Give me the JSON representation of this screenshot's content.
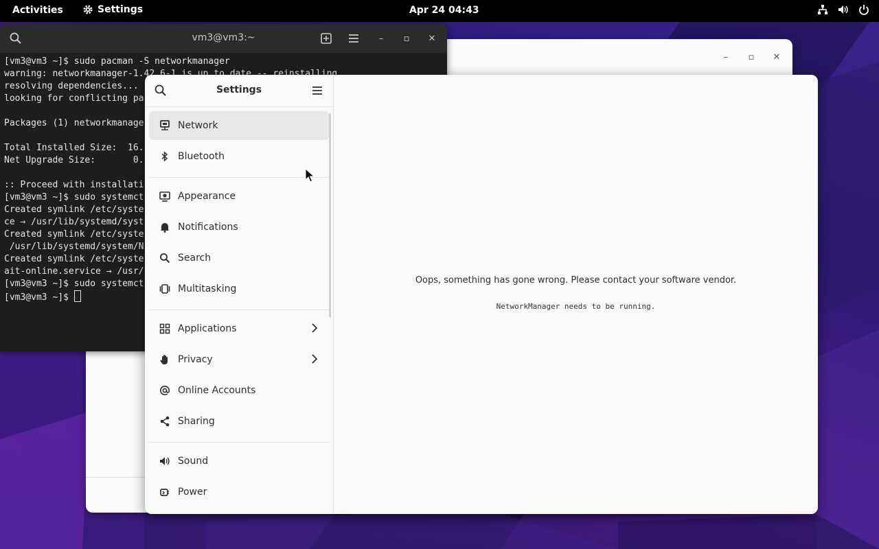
{
  "topbar": {
    "activities": "Activities",
    "app_name": "Settings",
    "clock": "Apr 24  04:43",
    "tray_icons": [
      "network-wired-icon",
      "volume-icon",
      "power-icon"
    ]
  },
  "terminal": {
    "title": "vm3@vm3:~",
    "lines": [
      "[vm3@vm3 ~]$ sudo pacman -S networkmanager",
      "warning: networkmanager-1.42.6-1 is up to date -- reinstalling",
      "resolving dependencies...",
      "looking for conflicting pa",
      "",
      "Packages (1) networkmanage",
      "",
      "Total Installed Size:  16.",
      "Net Upgrade Size:       0.",
      "",
      ":: Proceed with installati",
      "[vm3@vm3 ~]$ sudo systemct",
      "Created symlink /etc/syste",
      "ce → /usr/lib/systemd/syst",
      "Created symlink /etc/syste",
      " /usr/lib/systemd/system/N",
      "Created symlink /etc/syste",
      "ait-online.service → /usr/",
      "[vm3@vm3 ~]$ sudo systemct"
    ],
    "prompt": "[vm3@vm3 ~]$ "
  },
  "settings": {
    "title": "Settings",
    "sidebar": [
      {
        "label": "Network",
        "icon": "network-icon",
        "selected": true
      },
      {
        "label": "Bluetooth",
        "icon": "bluetooth-icon"
      },
      {
        "label": "Appearance",
        "icon": "appearance-icon"
      },
      {
        "label": "Notifications",
        "icon": "bell-icon"
      },
      {
        "label": "Search",
        "icon": "search-icon"
      },
      {
        "label": "Multitasking",
        "icon": "multitasking-icon"
      },
      {
        "label": "Applications",
        "icon": "apps-grid-icon",
        "has_submenu": true
      },
      {
        "label": "Privacy",
        "icon": "hand-icon",
        "has_submenu": true
      },
      {
        "label": "Online Accounts",
        "icon": "at-icon"
      },
      {
        "label": "Sharing",
        "icon": "share-icon"
      },
      {
        "label": "Sound",
        "icon": "speaker-icon"
      },
      {
        "label": "Power",
        "icon": "power-plug-icon"
      }
    ],
    "error_message": "Oops, something has gone wrong. Please contact your software vendor.",
    "error_detail": "NetworkManager needs to be running."
  }
}
